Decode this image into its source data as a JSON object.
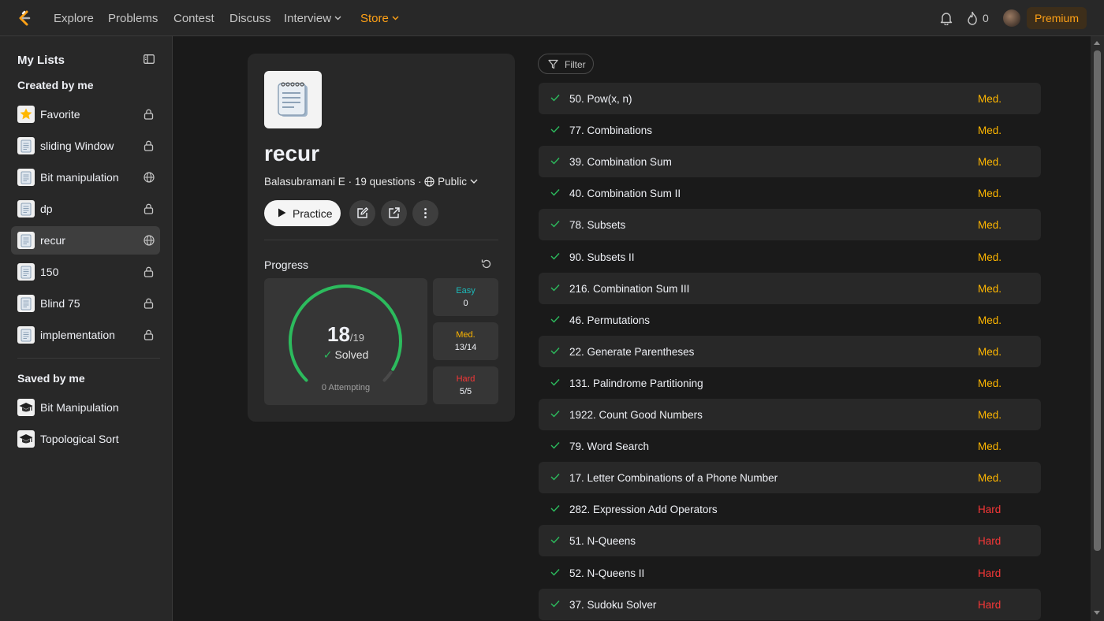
{
  "nav": {
    "items": [
      {
        "label": "Explore",
        "name": "nav-explore"
      },
      {
        "label": "Problems",
        "name": "nav-problems"
      },
      {
        "label": "Contest",
        "name": "nav-contest"
      },
      {
        "label": "Discuss",
        "name": "nav-discuss"
      },
      {
        "label": "Interview",
        "name": "nav-interview",
        "dropdown": true
      },
      {
        "label": "Store",
        "name": "nav-store",
        "dropdown": true,
        "accent": true
      }
    ],
    "streak_count": "0",
    "premium_label": "Premium",
    "accent_color": "#ffa116"
  },
  "sidebar": {
    "title": "My Lists",
    "created_label": "Created by me",
    "created": [
      {
        "label": "Favorite",
        "icon": "star-icon",
        "visibility": "lock-icon"
      },
      {
        "label": "sliding Window",
        "icon": "notepad-icon",
        "visibility": "lock-icon"
      },
      {
        "label": "Bit manipulation",
        "icon": "notepad-icon",
        "visibility": "globe-icon"
      },
      {
        "label": "dp",
        "icon": "notepad-icon",
        "visibility": "lock-icon"
      },
      {
        "label": "recur",
        "icon": "notepad-icon",
        "visibility": "globe-icon",
        "active": true
      },
      {
        "label": "150",
        "icon": "notepad-icon",
        "visibility": "lock-icon"
      },
      {
        "label": "Blind 75",
        "icon": "notepad-icon",
        "visibility": "lock-icon"
      },
      {
        "label": "implementation",
        "icon": "notepad-icon",
        "visibility": "lock-icon"
      }
    ],
    "saved_label": "Saved by me",
    "saved": [
      {
        "label": "Bit Manipulation",
        "icon": "grad-cap-icon"
      },
      {
        "label": "Topological Sort",
        "icon": "grad-cap-icon"
      }
    ]
  },
  "list": {
    "name": "recur",
    "owner": "Balasubramani E",
    "questions_text": "19 questions",
    "visibility": "Public",
    "practice_label": "Practice"
  },
  "progress": {
    "label": "Progress",
    "solved": "18",
    "total": "/19",
    "solved_label": "Solved",
    "attempting": "0 Attempting",
    "solved_fraction": 0.947,
    "easy": {
      "name": "Easy",
      "value": "0",
      "color": "#1cbaba"
    },
    "medium": {
      "name": "Med.",
      "value": "13/14",
      "color": "#ffb700"
    },
    "hard": {
      "name": "Hard",
      "value": "5/5",
      "color": "#f63737"
    },
    "ring_color": "#2cbb5d"
  },
  "filter_label": "Filter",
  "questions": [
    {
      "title": "50. Pow(x, n)",
      "difficulty": "Med."
    },
    {
      "title": "77. Combinations",
      "difficulty": "Med."
    },
    {
      "title": "39. Combination Sum",
      "difficulty": "Med."
    },
    {
      "title": "40. Combination Sum II",
      "difficulty": "Med."
    },
    {
      "title": "78. Subsets",
      "difficulty": "Med."
    },
    {
      "title": "90. Subsets II",
      "difficulty": "Med."
    },
    {
      "title": "216. Combination Sum III",
      "difficulty": "Med."
    },
    {
      "title": "46. Permutations",
      "difficulty": "Med."
    },
    {
      "title": "22. Generate Parentheses",
      "difficulty": "Med."
    },
    {
      "title": "131. Palindrome Partitioning",
      "difficulty": "Med."
    },
    {
      "title": "1922. Count Good Numbers",
      "difficulty": "Med."
    },
    {
      "title": "79. Word Search",
      "difficulty": "Med."
    },
    {
      "title": "17. Letter Combinations of a Phone Number",
      "difficulty": "Med."
    },
    {
      "title": "282. Expression Add Operators",
      "difficulty": "Hard"
    },
    {
      "title": "51. N-Queens",
      "difficulty": "Hard"
    },
    {
      "title": "52. N-Queens II",
      "difficulty": "Hard"
    },
    {
      "title": "37. Sudoku Solver",
      "difficulty": "Hard"
    }
  ]
}
